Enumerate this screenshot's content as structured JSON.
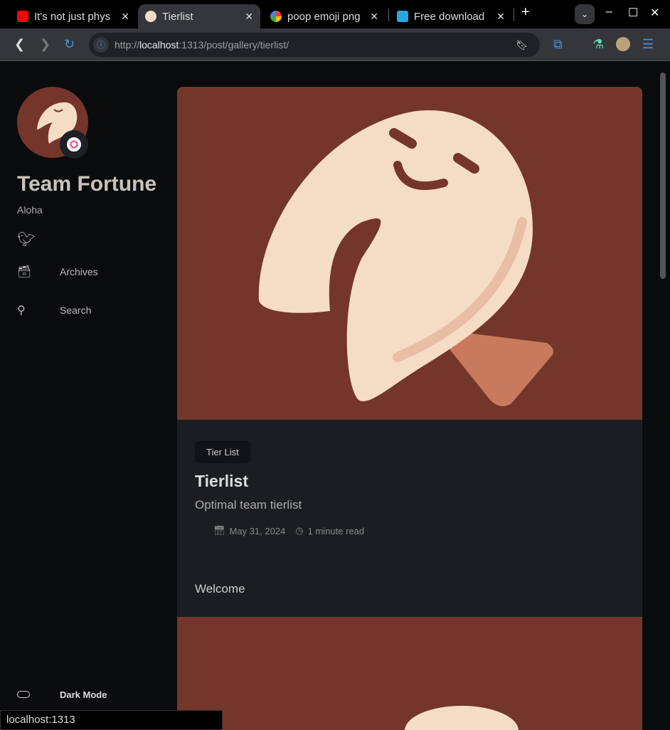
{
  "browser": {
    "tabs": [
      {
        "title": "It's not just phys",
        "icon": "youtube-icon"
      },
      {
        "title": "Tierlist",
        "icon": "fortune-cookie-icon"
      },
      {
        "title": "poop emoji png",
        "icon": "google-icon"
      },
      {
        "title": "Free download",
        "icon": "w-logo-icon"
      }
    ],
    "url_prefix": "http://",
    "url_host": "localhost",
    "url_rest": ":1313/post/gallery/tierlist/",
    "status": "localhost:1313"
  },
  "sidebar": {
    "name": "Team Fortune",
    "tagline": "Aloha",
    "items": [
      {
        "label": "Archives",
        "icon": "archive-icon"
      },
      {
        "label": "Search",
        "icon": "search-icon"
      }
    ],
    "dark_mode": "Dark Mode"
  },
  "post": {
    "category": "Tier List",
    "title": "Tierlist",
    "subtitle": "Optimal team tierlist",
    "date": "May 31, 2024",
    "read_time": "1 minute read",
    "content": "Welcome"
  },
  "colors": {
    "hero": "#74362a",
    "cookie": "#f5dcc4"
  }
}
